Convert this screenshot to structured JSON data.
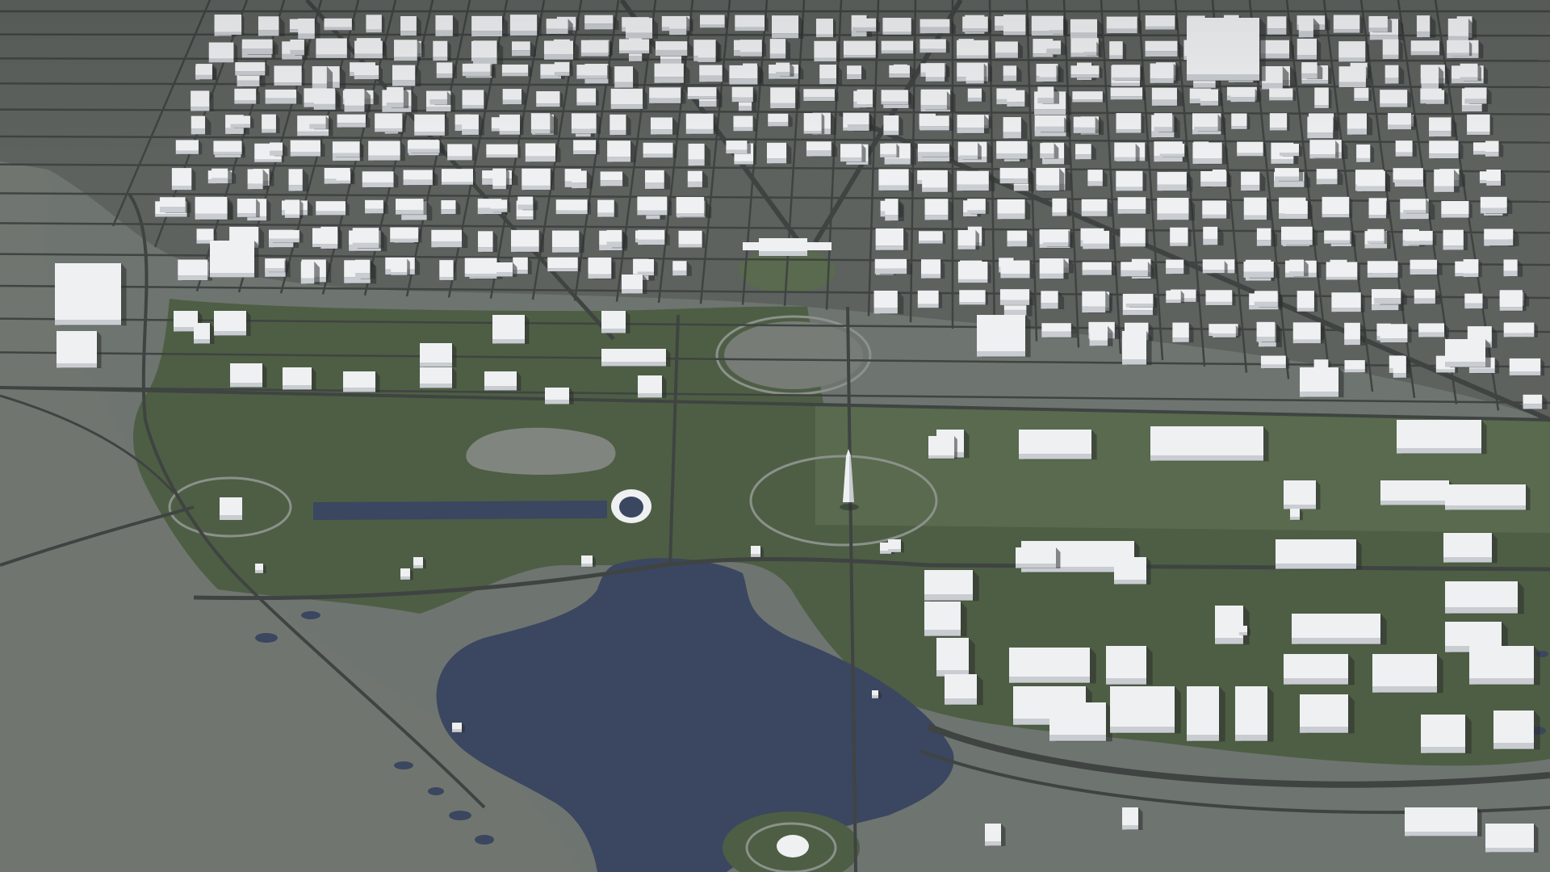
{
  "palette": {
    "ground": "#6e7470",
    "river": "#70766f",
    "park": "#4e5e44",
    "park_light": "#596a4e",
    "water": "#3b4660",
    "road": "#3f4442",
    "path": "#8b918b",
    "building": "#eef0f2",
    "building_side": "#c9ccd1",
    "shadow": "#2c302d"
  },
  "landmarks": [
    {
      "id": "tidal-basin",
      "kind": "water"
    },
    {
      "id": "reflecting-pool",
      "kind": "water"
    },
    {
      "id": "constitution-gardens-pond",
      "kind": "water"
    },
    {
      "id": "washington-monument",
      "kind": "obelisk"
    },
    {
      "id": "the-ellipse",
      "kind": "lawn"
    },
    {
      "id": "lincoln-memorial",
      "kind": "monument"
    },
    {
      "id": "world-war-ii-memorial",
      "kind": "monument"
    },
    {
      "id": "jefferson-memorial",
      "kind": "monument"
    },
    {
      "id": "white-house",
      "kind": "building"
    },
    {
      "id": "national-mall",
      "kind": "park"
    },
    {
      "id": "potomac-river",
      "kind": "river"
    }
  ]
}
